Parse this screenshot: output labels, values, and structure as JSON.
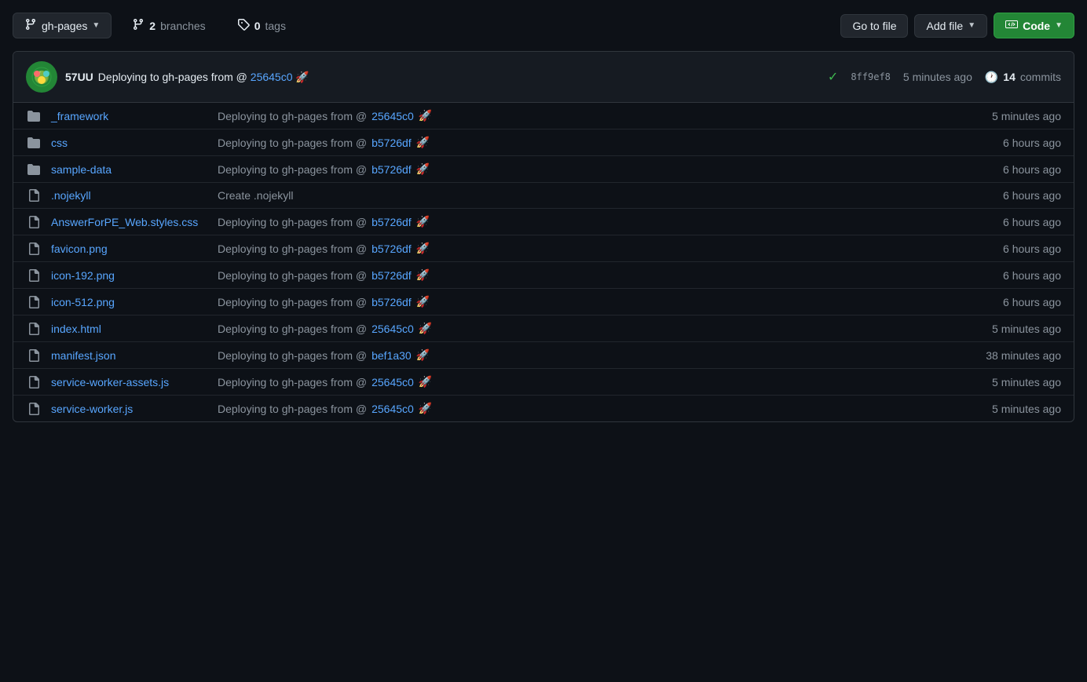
{
  "toolbar": {
    "branch_icon": "⎇",
    "branch_name": "gh-pages",
    "branch_dropdown_label": "gh-pages",
    "branches_count": "2",
    "branches_label": "branches",
    "tags_count": "0",
    "tags_label": "tags",
    "go_to_file_label": "Go to file",
    "add_file_label": "Add file",
    "code_label": "Code"
  },
  "commit_header": {
    "avatar_emoji": "🟢",
    "user_name": "57UU",
    "message": "Deploying to gh-pages from @",
    "hash": "25645c0",
    "rocket": "🚀",
    "check": "✓",
    "sha": "8ff9ef8",
    "time": "5 minutes ago",
    "commits_count": "14",
    "commits_label": "commits"
  },
  "files": [
    {
      "type": "folder",
      "name": "_framework",
      "commit_msg": "Deploying to gh-pages from @",
      "hash": "25645c0",
      "hash_color": "#58a6ff",
      "rocket": "🚀",
      "time": "5 minutes ago"
    },
    {
      "type": "folder",
      "name": "css",
      "commit_msg": "Deploying to gh-pages from @",
      "hash": "b5726df",
      "hash_color": "#58a6ff",
      "rocket": "🚀",
      "time": "6 hours ago"
    },
    {
      "type": "folder",
      "name": "sample-data",
      "commit_msg": "Deploying to gh-pages from @",
      "hash": "b5726df",
      "hash_color": "#58a6ff",
      "rocket": "🚀",
      "time": "6 hours ago"
    },
    {
      "type": "file",
      "name": ".nojekyll",
      "commit_msg": "Create .nojekyll",
      "hash": "",
      "hash_color": "",
      "rocket": "",
      "time": "6 hours ago"
    },
    {
      "type": "file",
      "name": "AnswerForPE_Web.styles.css",
      "commit_msg": "Deploying to gh-pages from @",
      "hash": "b5726df",
      "hash_color": "#58a6ff",
      "rocket": "🚀",
      "time": "6 hours ago"
    },
    {
      "type": "file",
      "name": "favicon.png",
      "commit_msg": "Deploying to gh-pages from @",
      "hash": "b5726df",
      "hash_color": "#58a6ff",
      "rocket": "🚀",
      "time": "6 hours ago"
    },
    {
      "type": "file",
      "name": "icon-192.png",
      "commit_msg": "Deploying to gh-pages from @",
      "hash": "b5726df",
      "hash_color": "#58a6ff",
      "rocket": "🚀",
      "time": "6 hours ago"
    },
    {
      "type": "file",
      "name": "icon-512.png",
      "commit_msg": "Deploying to gh-pages from @",
      "hash": "b5726df",
      "hash_color": "#58a6ff",
      "rocket": "🚀",
      "time": "6 hours ago"
    },
    {
      "type": "file",
      "name": "index.html",
      "commit_msg": "Deploying to gh-pages from @",
      "hash": "25645c0",
      "hash_color": "#58a6ff",
      "rocket": "🚀",
      "time": "5 minutes ago"
    },
    {
      "type": "file",
      "name": "manifest.json",
      "commit_msg": "Deploying to gh-pages from @",
      "hash": "bef1a30",
      "hash_color": "#58a6ff",
      "rocket": "🚀",
      "time": "38 minutes ago"
    },
    {
      "type": "file",
      "name": "service-worker-assets.js",
      "commit_msg": "Deploying to gh-pages from @",
      "hash": "25645c0",
      "hash_color": "#58a6ff",
      "rocket": "🚀",
      "time": "5 minutes ago"
    },
    {
      "type": "file",
      "name": "service-worker.js",
      "commit_msg": "Deploying to gh-pages from @",
      "hash": "25645c0",
      "hash_color": "#58a6ff",
      "rocket": "🚀",
      "time": "5 minutes ago"
    }
  ]
}
